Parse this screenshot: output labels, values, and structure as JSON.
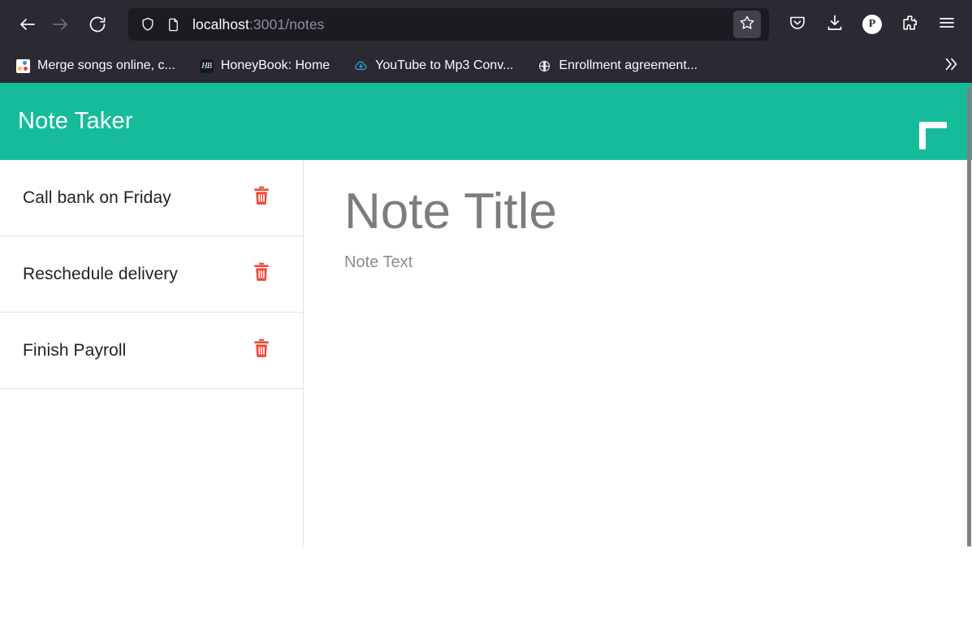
{
  "browser": {
    "nav": {
      "back_label": "Back",
      "back_icon": "arrow-left-icon",
      "forward_label": "Forward",
      "forward_icon": "arrow-right-icon",
      "reload_label": "Reload",
      "reload_icon": "reload-icon"
    },
    "urlbar": {
      "shield_icon": "shield-icon",
      "page_icon": "page-document-icon",
      "url_host": "localhost",
      "url_path": ":3001/notes",
      "url_full": "localhost:3001/notes",
      "bookmark_star_icon": "star-icon",
      "bookmark_star_label": "Bookmark this page"
    },
    "actions": [
      {
        "name": "pocket-icon",
        "label": "Save to Pocket"
      },
      {
        "name": "downloads-icon",
        "label": "Downloads"
      },
      {
        "name": "account-avatar",
        "label": "P"
      },
      {
        "name": "extensions-icon",
        "label": "Extensions"
      },
      {
        "name": "menu-hamburger-icon",
        "label": "Open application menu"
      }
    ],
    "bookmarks": [
      {
        "label": "Merge songs online, c...",
        "icon": "merge-songs-favicon"
      },
      {
        "label": "HoneyBook: Home",
        "icon": "honeybook-favicon"
      },
      {
        "label": "YouTube to Mp3 Conv...",
        "icon": "cloud-download-favicon"
      },
      {
        "label": "Enrollment agreement...",
        "icon": "globe-favicon"
      }
    ],
    "bookmarks_overflow_icon": "chevron-double-right-icon",
    "bookmarks_overflow_label": "Show more bookmarks"
  },
  "app": {
    "title": "Note Taker",
    "accent_color": "#16bc9a",
    "add_button": {
      "label": "Add note",
      "icon": "plus-icon"
    },
    "notes": [
      {
        "title": "Call bank on Friday",
        "delete_icon": "trash-icon",
        "delete_label": "Delete note"
      },
      {
        "title": "Reschedule delivery",
        "delete_icon": "trash-icon",
        "delete_label": "Delete note"
      },
      {
        "title": "Finish Payroll",
        "delete_icon": "trash-icon",
        "delete_label": "Delete note"
      }
    ],
    "editor": {
      "title_value": "",
      "title_placeholder": "Note Title",
      "text_value": "",
      "text_placeholder": "Note Text",
      "placeholder_color": "#7d7d7d"
    }
  }
}
